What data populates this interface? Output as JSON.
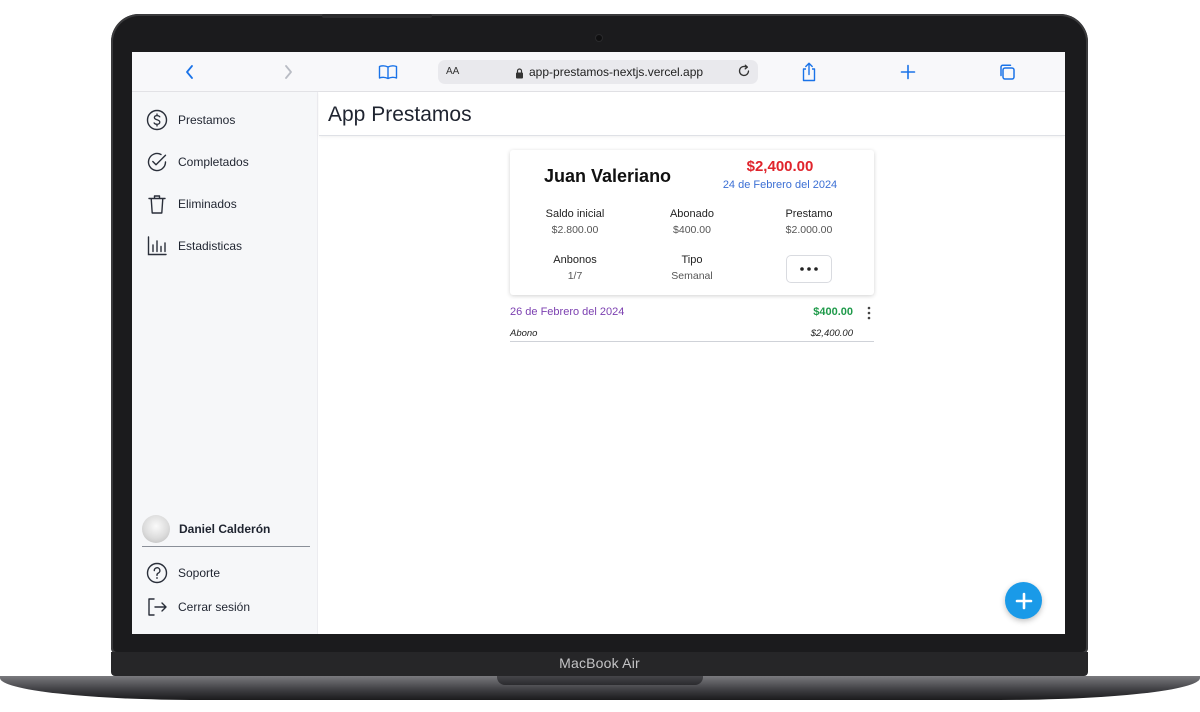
{
  "device": {
    "brand_label": "MacBook Air"
  },
  "browser": {
    "url_text_size_label": "AA",
    "url": "app-prestamos-nextjs.vercel.app",
    "icons": [
      "chevron-left-icon",
      "chevron-right-icon",
      "book-icon",
      "lock-icon",
      "reload-icon",
      "share-icon",
      "plus-icon",
      "tabs-icon"
    ]
  },
  "sidebar": {
    "items": [
      {
        "label": "Prestamos",
        "icon": "dollar-circle-icon"
      },
      {
        "label": "Completados",
        "icon": "check-circle-icon"
      },
      {
        "label": "Eliminados",
        "icon": "trash-icon"
      },
      {
        "label": "Estadisticas",
        "icon": "bar-chart-icon"
      }
    ],
    "user": {
      "name": "Daniel Calderón"
    },
    "bottom_items": [
      {
        "label": "Soporte",
        "icon": "help-circle-icon"
      },
      {
        "label": "Cerrar sesión",
        "icon": "logout-icon"
      }
    ]
  },
  "header": {
    "title": "App Prestamos"
  },
  "loan_card": {
    "client_name": "Juan Valeriano",
    "total_amount": "$2,400.00",
    "date": "24 de Febrero del 2024",
    "stats": [
      {
        "label": "Saldo inicial",
        "value": "$2.800.00"
      },
      {
        "label": "Abonado",
        "value": "$400.00"
      },
      {
        "label": "Prestamo",
        "value": "$2.000.00"
      },
      {
        "label": "Anbonos",
        "value": "1/7"
      },
      {
        "label": "Tipo",
        "value": "Semanal"
      }
    ]
  },
  "payments": [
    {
      "date": "26 de Febrero del 2024",
      "amount": "$400.00",
      "type": "Abono",
      "balance": "$2,400.00"
    }
  ],
  "colors": {
    "amount_red": "#e0242c",
    "date_blue": "#3b6fd4",
    "payment_date_purple": "#7b3fb0",
    "payment_amount_green": "#1f9a4a",
    "fab_blue": "#1a9ae8",
    "safari_accent": "#1a73e8"
  }
}
